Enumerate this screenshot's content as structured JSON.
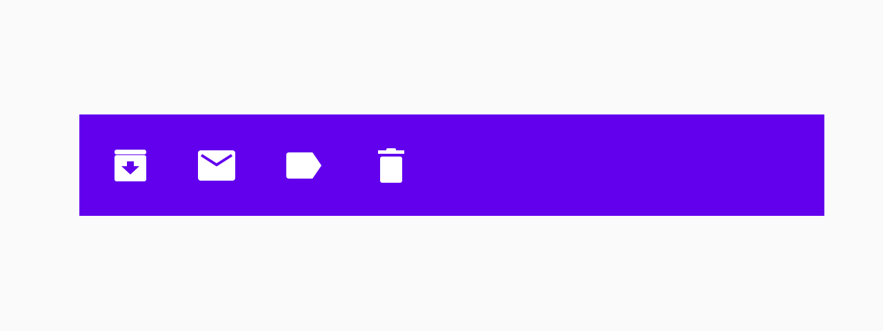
{
  "colors": {
    "background": "#fafafa",
    "toolbar": "#6200ee",
    "icon": "#ffffff"
  },
  "toolbar": {
    "actions": [
      {
        "icon": "archive-icon"
      },
      {
        "icon": "mail-icon"
      },
      {
        "icon": "label-icon"
      },
      {
        "icon": "delete-icon"
      }
    ]
  }
}
